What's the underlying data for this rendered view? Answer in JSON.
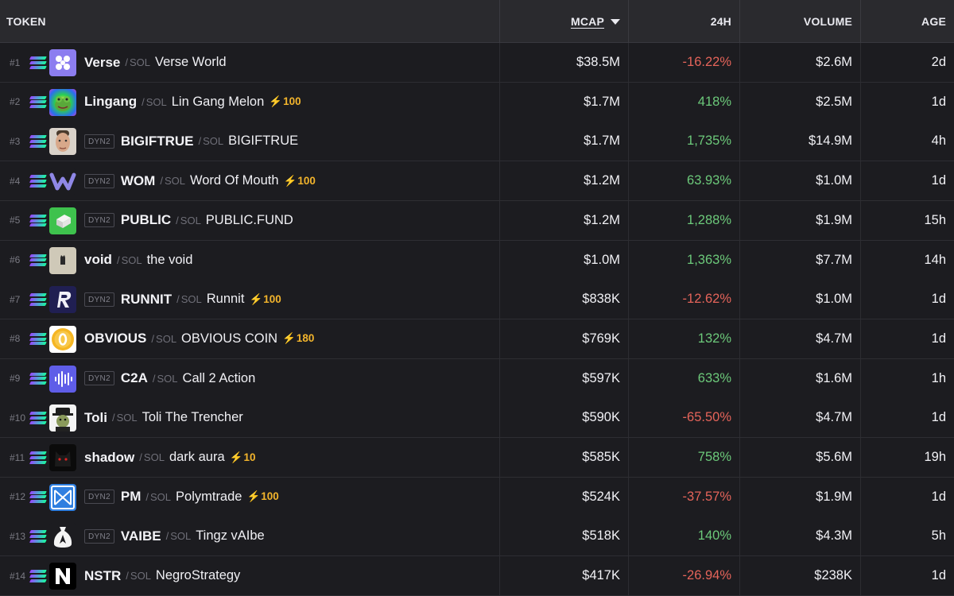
{
  "header": {
    "token": "TOKEN",
    "mcap": "MCAP",
    "change": "24H",
    "volume": "VOLUME",
    "age": "AGE"
  },
  "chain_label": "SOL",
  "dyn_label": "DYN2",
  "colors": {
    "negative": "#e5645a",
    "positive": "#6cc97a",
    "boost": "#f2b42c"
  },
  "rows": [
    {
      "rank": "#1",
      "symbol": "Verse",
      "name": "Verse World",
      "dyn": false,
      "boost": "",
      "mcap": "$38.5M",
      "change": "-16.22%",
      "dir": "neg",
      "volume": "$2.6M",
      "age": "2d",
      "icon": "verse-icon"
    },
    {
      "rank": "#2",
      "symbol": "Lingang",
      "name": "Lin Gang Melon",
      "dyn": false,
      "boost": "100",
      "mcap": "$1.7M",
      "change": "418%",
      "dir": "pos",
      "volume": "$2.5M",
      "age": "1d",
      "icon": "frog-icon"
    },
    {
      "rank": "#3",
      "symbol": "BIGIFTRUE",
      "name": "BIGIFTRUE",
      "dyn": true,
      "boost": "",
      "mcap": "$1.7M",
      "change": "1,735%",
      "dir": "pos",
      "volume": "$14.9M",
      "age": "4h",
      "icon": "face-icon"
    },
    {
      "rank": "#4",
      "symbol": "WOM",
      "name": "Word Of Mouth",
      "dyn": true,
      "boost": "100",
      "mcap": "$1.2M",
      "change": "63.93%",
      "dir": "pos",
      "volume": "$1.0M",
      "age": "1d",
      "icon": "w-logo-icon"
    },
    {
      "rank": "#5",
      "symbol": "PUBLIC",
      "name": "PUBLIC.FUND",
      "dyn": true,
      "boost": "",
      "mcap": "$1.2M",
      "change": "1,288%",
      "dir": "pos",
      "volume": "$1.9M",
      "age": "15h",
      "icon": "cube-icon"
    },
    {
      "rank": "#6",
      "symbol": "void",
      "name": "the void",
      "dyn": false,
      "boost": "",
      "mcap": "$1.0M",
      "change": "1,363%",
      "dir": "pos",
      "volume": "$7.7M",
      "age": "14h",
      "icon": "cat-icon"
    },
    {
      "rank": "#7",
      "symbol": "RUNNIT",
      "name": "Runnit",
      "dyn": true,
      "boost": "100",
      "mcap": "$838K",
      "change": "-12.62%",
      "dir": "neg",
      "volume": "$1.0M",
      "age": "1d",
      "icon": "r-logo-icon"
    },
    {
      "rank": "#8",
      "symbol": "OBVIOUS",
      "name": "OBVIOUS COIN",
      "dyn": false,
      "boost": "180",
      "mcap": "$769K",
      "change": "132%",
      "dir": "pos",
      "volume": "$4.7M",
      "age": "1d",
      "icon": "coin-icon"
    },
    {
      "rank": "#9",
      "symbol": "C2A",
      "name": "Call 2 Action",
      "dyn": true,
      "boost": "",
      "mcap": "$597K",
      "change": "633%",
      "dir": "pos",
      "volume": "$1.6M",
      "age": "1h",
      "icon": "waveform-icon"
    },
    {
      "rank": "#10",
      "symbol": "Toli",
      "name": "Toli The Trencher",
      "dyn": false,
      "boost": "",
      "mcap": "$590K",
      "change": "-65.50%",
      "dir": "neg",
      "volume": "$4.7M",
      "age": "1d",
      "icon": "character-icon"
    },
    {
      "rank": "#11",
      "symbol": "shadow",
      "name": "dark aura",
      "dyn": false,
      "boost": "10",
      "mcap": "$585K",
      "change": "758%",
      "dir": "pos",
      "volume": "$5.6M",
      "age": "19h",
      "icon": "shadow-cat-icon"
    },
    {
      "rank": "#12",
      "symbol": "PM",
      "name": "Polymtrade",
      "dyn": true,
      "boost": "100",
      "mcap": "$524K",
      "change": "-37.57%",
      "dir": "neg",
      "volume": "$1.9M",
      "age": "1d",
      "icon": "bowtie-icon"
    },
    {
      "rank": "#13",
      "symbol": "VAIBE",
      "name": "Tingz vAIbe",
      "dyn": true,
      "boost": "",
      "mcap": "$518K",
      "change": "140%",
      "dir": "pos",
      "volume": "$4.3M",
      "age": "5h",
      "icon": "moneybag-icon"
    },
    {
      "rank": "#14",
      "symbol": "NSTR",
      "name": "NegroStrategy",
      "dyn": false,
      "boost": "",
      "mcap": "$417K",
      "change": "-26.94%",
      "dir": "neg",
      "volume": "$238K",
      "age": "1d",
      "icon": "n-logo-icon"
    }
  ]
}
